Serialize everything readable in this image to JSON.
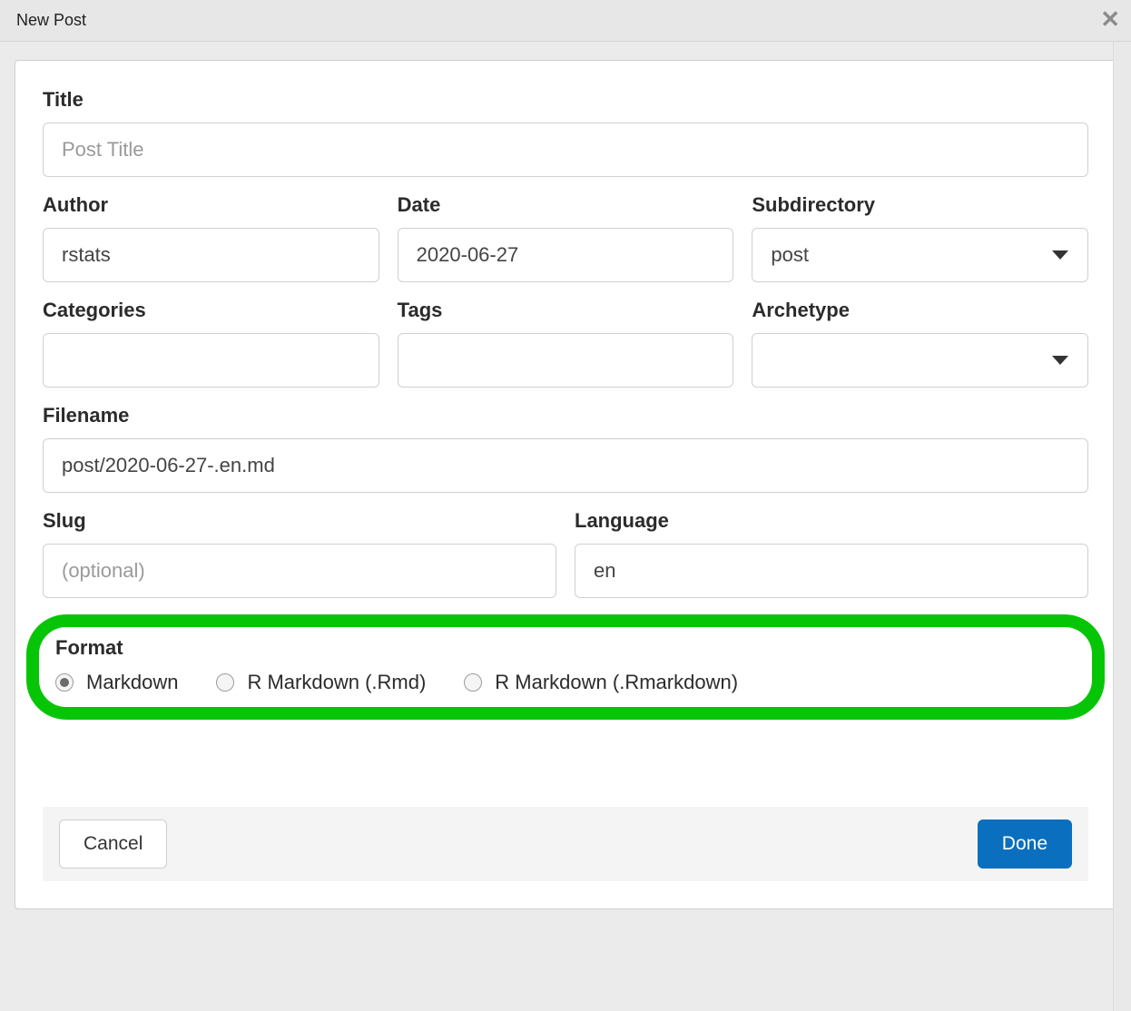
{
  "dialog": {
    "title": "New Post"
  },
  "fields": {
    "title": {
      "label": "Title",
      "placeholder": "Post Title",
      "value": ""
    },
    "author": {
      "label": "Author",
      "value": "rstats"
    },
    "date": {
      "label": "Date",
      "value": "2020-06-27"
    },
    "subdirectory": {
      "label": "Subdirectory",
      "value": "post"
    },
    "categories": {
      "label": "Categories",
      "value": ""
    },
    "tags": {
      "label": "Tags",
      "value": ""
    },
    "archetype": {
      "label": "Archetype",
      "value": ""
    },
    "filename": {
      "label": "Filename",
      "value": "post/2020-06-27-.en.md"
    },
    "slug": {
      "label": "Slug",
      "placeholder": "(optional)",
      "value": ""
    },
    "language": {
      "label": "Language",
      "value": "en"
    },
    "format": {
      "label": "Format",
      "options": [
        {
          "label": "Markdown",
          "selected": true
        },
        {
          "label": "R Markdown (.Rmd)",
          "selected": false
        },
        {
          "label": "R Markdown (.Rmarkdown)",
          "selected": false
        }
      ]
    }
  },
  "buttons": {
    "cancel": "Cancel",
    "done": "Done"
  }
}
